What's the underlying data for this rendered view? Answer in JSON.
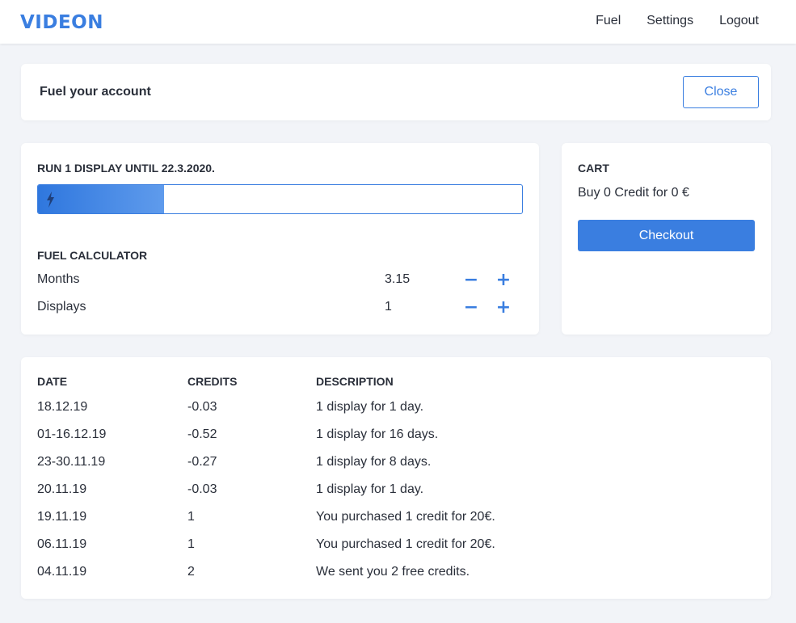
{
  "nav": {
    "logo": "VIDEON",
    "items": [
      {
        "label": "Fuel"
      },
      {
        "label": "Settings"
      },
      {
        "label": "Logout"
      }
    ]
  },
  "header": {
    "title": "Fuel your account",
    "close_label": "Close"
  },
  "fuel": {
    "run_label": "RUN 1 DISPLAY UNTIL 22.3.2020.",
    "fill_percent": 26,
    "calculator_label": "FUEL CALCULATOR",
    "rows": [
      {
        "label": "Months",
        "value": "3.15",
        "minus": "−",
        "plus": "+"
      },
      {
        "label": "Displays",
        "value": "1",
        "minus": "−",
        "plus": "+"
      }
    ],
    "icon": "bolt-icon"
  },
  "cart": {
    "title": "CART",
    "summary": "Buy 0 Credit for 0 €",
    "checkout_label": "Checkout"
  },
  "history": {
    "columns": [
      "DATE",
      "CREDITS",
      "DESCRIPTION"
    ],
    "rows": [
      {
        "date": "18.12.19",
        "credits": "-0.03",
        "description": "1 display for 1 day."
      },
      {
        "date": "01-16.12.19",
        "credits": "-0.52",
        "description": "1 display for 16 days."
      },
      {
        "date": "23-30.11.19",
        "credits": "-0.27",
        "description": "1 display for 8 days."
      },
      {
        "date": "20.11.19",
        "credits": "-0.03",
        "description": "1 display for 1 day."
      },
      {
        "date": "19.11.19",
        "credits": "1",
        "description": "You purchased 1 credit for 20€."
      },
      {
        "date": "06.11.19",
        "credits": "1",
        "description": "You purchased 1 credit for 20€."
      },
      {
        "date": "04.11.19",
        "credits": "2",
        "description": "We sent you 2 free credits."
      }
    ]
  },
  "colors": {
    "accent": "#3a7ee0",
    "background": "#f2f4f8",
    "text": "#2a2f3a"
  }
}
